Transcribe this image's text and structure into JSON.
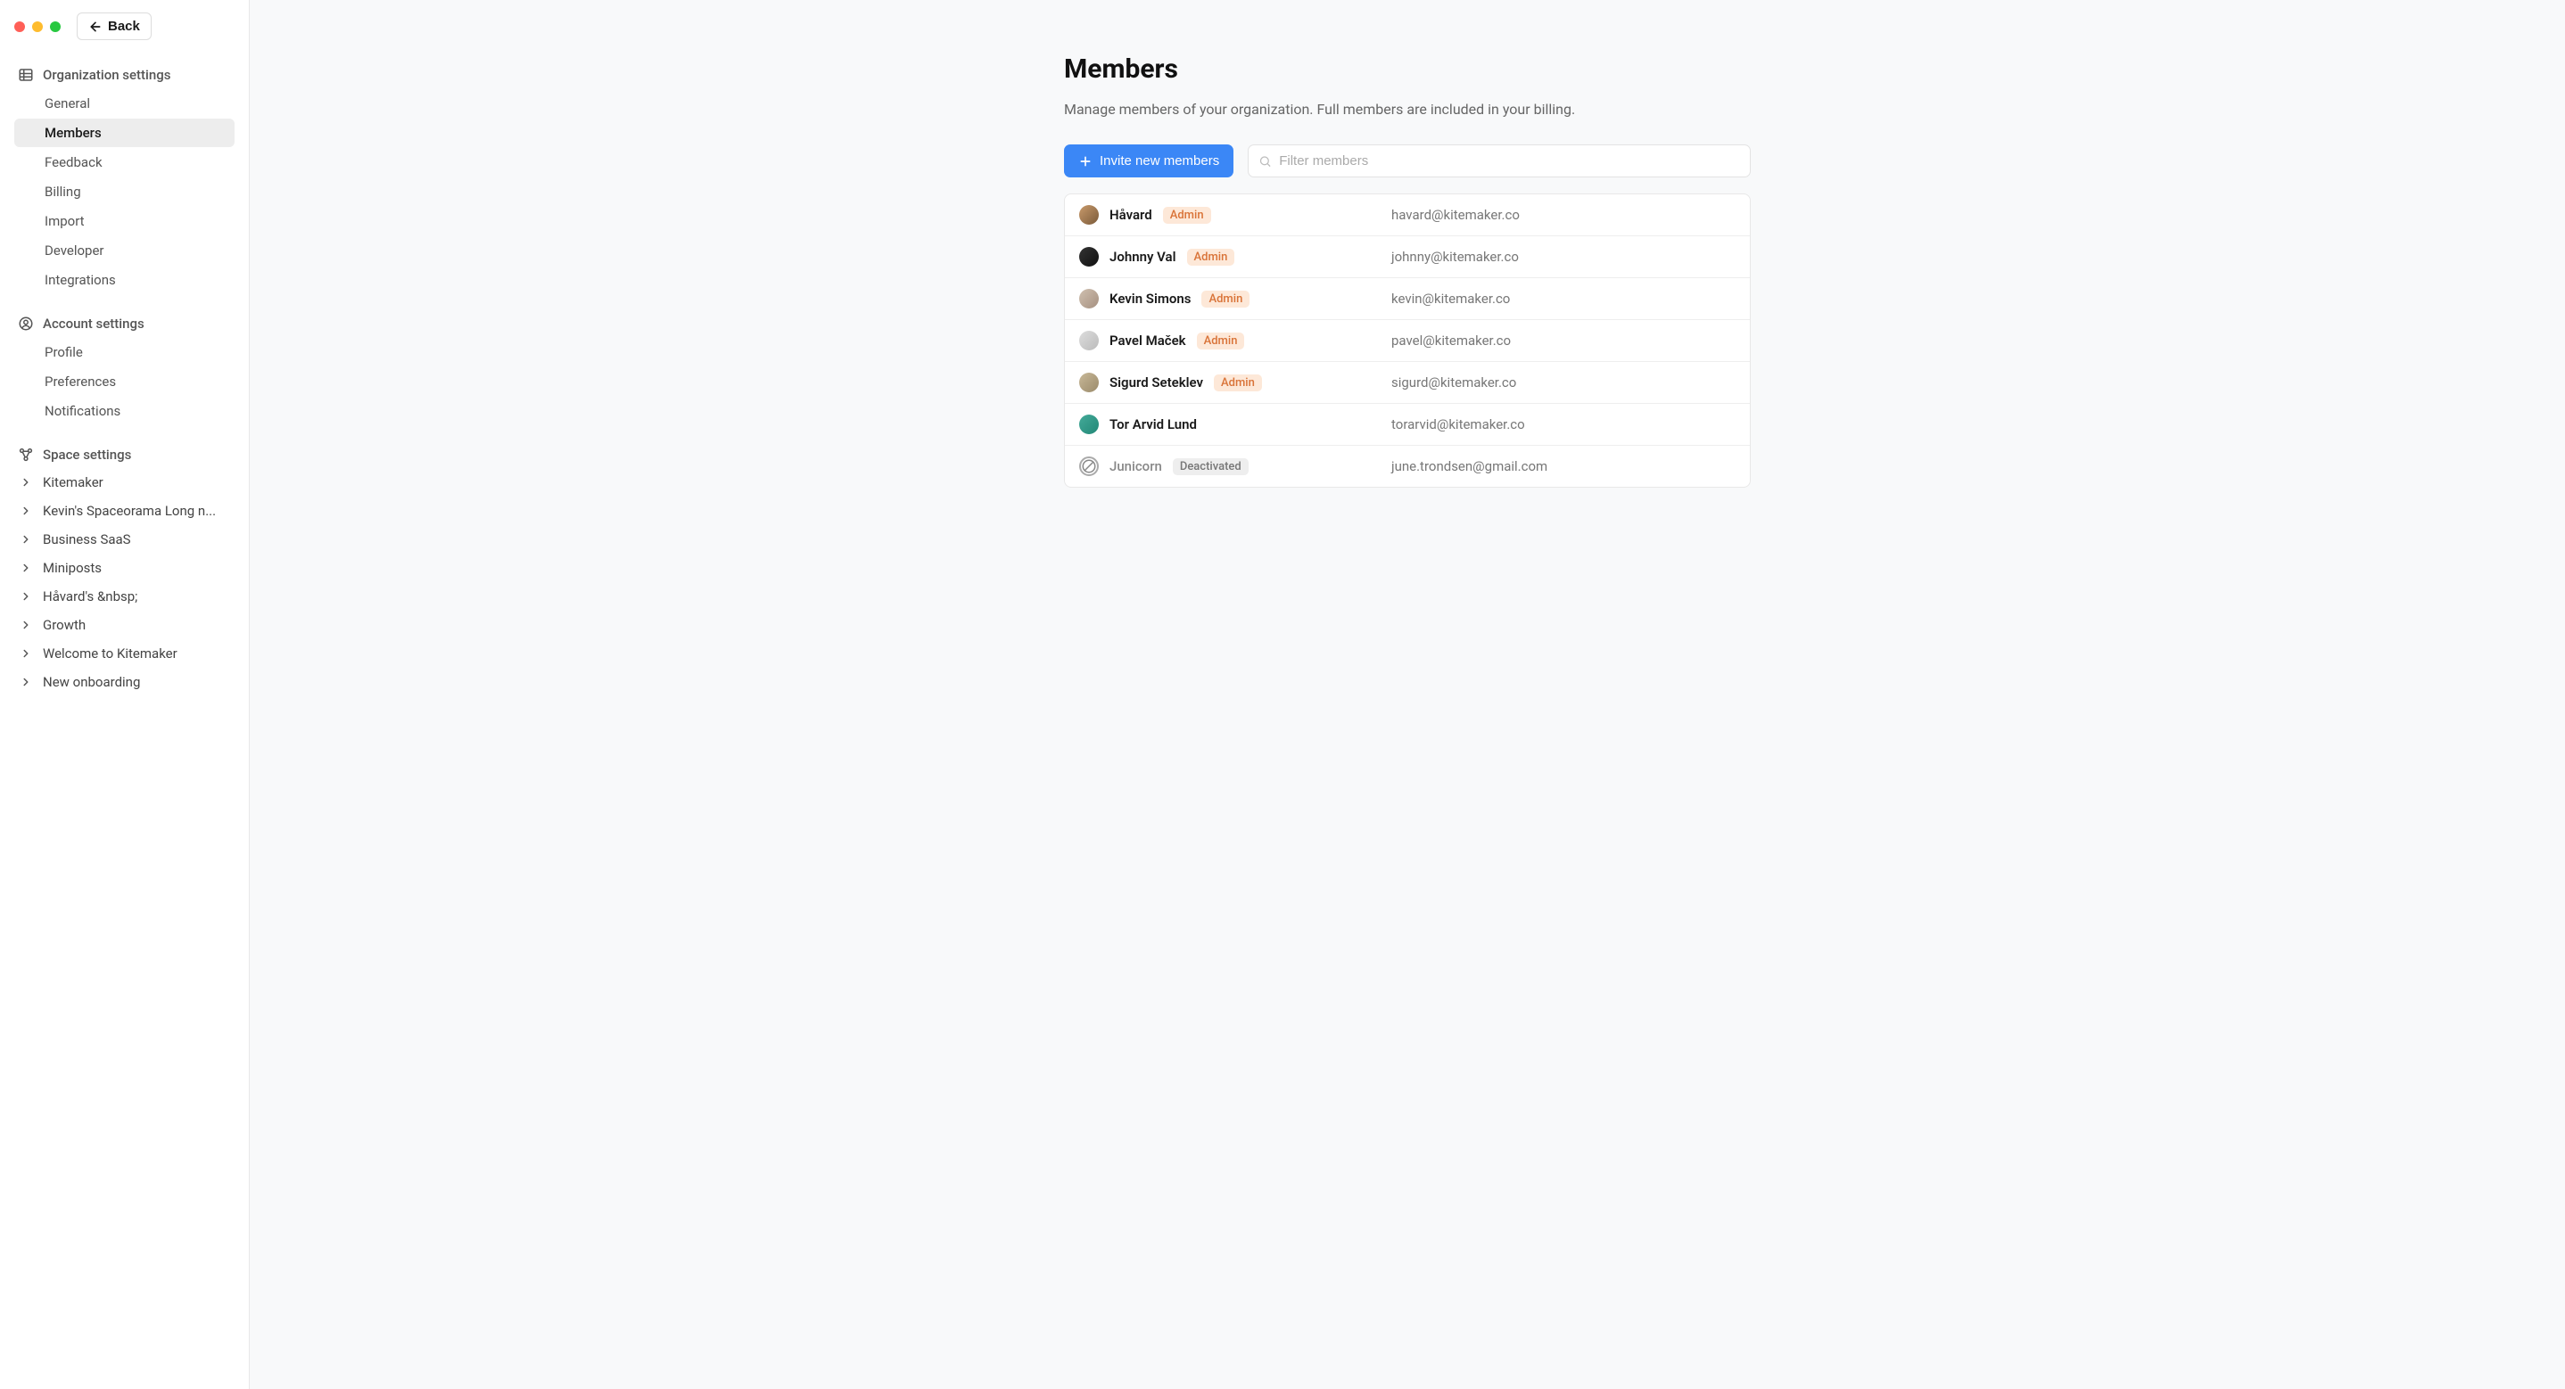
{
  "window": {
    "back_label": "Back"
  },
  "sidebar": {
    "org": {
      "title": "Organization settings",
      "items": [
        {
          "label": "General",
          "active": false
        },
        {
          "label": "Members",
          "active": true
        },
        {
          "label": "Feedback",
          "active": false
        },
        {
          "label": "Billing",
          "active": false
        },
        {
          "label": "Import",
          "active": false
        },
        {
          "label": "Developer",
          "active": false
        },
        {
          "label": "Integrations",
          "active": false
        }
      ]
    },
    "account": {
      "title": "Account settings",
      "items": [
        {
          "label": "Profile"
        },
        {
          "label": "Preferences"
        },
        {
          "label": "Notifications"
        }
      ]
    },
    "spaces": {
      "title": "Space settings",
      "items": [
        {
          "label": "Kitemaker"
        },
        {
          "label": "Kevin's Spaceorama Long n..."
        },
        {
          "label": "Business SaaS"
        },
        {
          "label": "Miniposts"
        },
        {
          "label": "Håvard's &nbsp;"
        },
        {
          "label": "Growth"
        },
        {
          "label": "Welcome to Kitemaker"
        },
        {
          "label": "New onboarding"
        }
      ]
    }
  },
  "main": {
    "title": "Members",
    "subtitle": "Manage members of your organization. Full members are included in your billing.",
    "invite_button": "Invite new members",
    "filter_placeholder": "Filter members",
    "badges": {
      "admin": "Admin",
      "deactivated": "Deactivated"
    },
    "members": [
      {
        "name": "Håvard",
        "email": "havard@kitemaker.co",
        "role": "admin",
        "avatar_bg": "linear-gradient(135deg,#c99a6b,#7a5a3a)"
      },
      {
        "name": "Johnny Val",
        "email": "johnny@kitemaker.co",
        "role": "admin",
        "avatar_bg": "linear-gradient(135deg,#333,#111)"
      },
      {
        "name": "Kevin Simons",
        "email": "kevin@kitemaker.co",
        "role": "admin",
        "avatar_bg": "linear-gradient(135deg,#d0c0b0,#a59080)"
      },
      {
        "name": "Pavel Maček",
        "email": "pavel@kitemaker.co",
        "role": "admin",
        "avatar_bg": "linear-gradient(135deg,#ddd,#bbb)"
      },
      {
        "name": "Sigurd Seteklev",
        "email": "sigurd@kitemaker.co",
        "role": "admin",
        "avatar_bg": "linear-gradient(135deg,#c8b898,#9a8a6a)"
      },
      {
        "name": "Tor Arvid Lund",
        "email": "torarvid@kitemaker.co",
        "role": "member",
        "avatar_bg": "linear-gradient(135deg,#4a9,#287)"
      },
      {
        "name": "Junicorn",
        "email": "june.trondsen@gmail.com",
        "role": "deactivated",
        "avatar_bg": ""
      }
    ]
  }
}
